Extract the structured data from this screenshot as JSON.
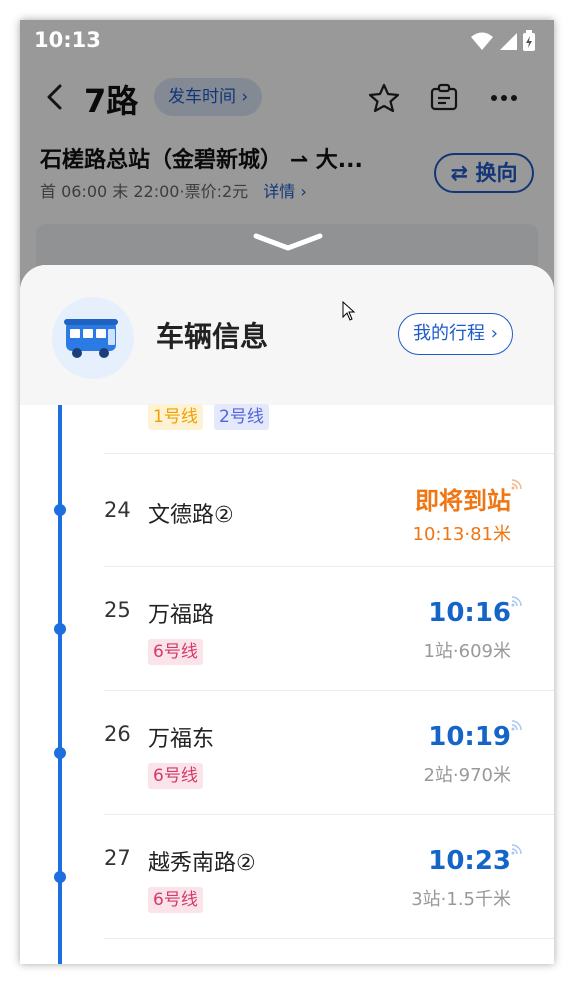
{
  "status_bar": {
    "time": "10:13"
  },
  "header": {
    "route": "7路",
    "depart_time_button": "发车时间",
    "switch_direction_button": "换向",
    "route_name": "石槎路总站（金碧新城）",
    "route_arrow": "⇀",
    "route_destination": "大...",
    "route_info": "首 06:00 末 22:00·票价:2元",
    "details_link": "详情"
  },
  "sheet": {
    "title": "车辆信息",
    "my_trip_button": "我的行程"
  },
  "stations": [
    {
      "number": "",
      "name": "",
      "tags": [
        {
          "label": "1号线",
          "line": "l1"
        },
        {
          "label": "2号线",
          "line": "l2"
        }
      ],
      "eta": "",
      "eta_sub": ""
    },
    {
      "number": "24",
      "name": "文德路②",
      "tags": [],
      "eta": "即将到站",
      "eta_sub": "10:13·81米",
      "arriving": true
    },
    {
      "number": "25",
      "name": "万福路",
      "tags": [
        {
          "label": "6号线",
          "line": "l6"
        }
      ],
      "eta": "10:16",
      "eta_sub": "1站·609米"
    },
    {
      "number": "26",
      "name": "万福东",
      "tags": [
        {
          "label": "6号线",
          "line": "l6"
        }
      ],
      "eta": "10:19",
      "eta_sub": "2站·970米"
    },
    {
      "number": "27",
      "name": "越秀南路②",
      "tags": [
        {
          "label": "6号线",
          "line": "l6"
        }
      ],
      "eta": "10:23",
      "eta_sub": "3站·1.5千米"
    }
  ],
  "colors": {
    "accent_blue": "#1f5bc8",
    "timeline_blue": "#1d6fe0",
    "arriving_orange": "#f07513",
    "line6": "#d33b6a",
    "line1": "#f0a000",
    "line2": "#5366d8"
  }
}
